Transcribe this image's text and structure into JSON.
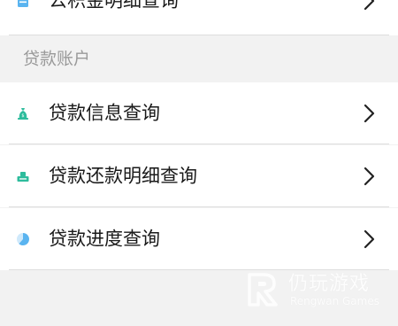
{
  "top_row": {
    "label": "公积金明细查询",
    "icon": "document-icon"
  },
  "section": {
    "title": "贷款账户"
  },
  "loan_items": [
    {
      "label": "贷款信息查询",
      "icon": "money-bag-icon"
    },
    {
      "label": "贷款还款明细查询",
      "icon": "repayment-tray-icon"
    },
    {
      "label": "贷款进度查询",
      "icon": "progress-pie-icon"
    }
  ],
  "watermark": {
    "title": "仍玩游戏",
    "subtitle": "Rengwan Games"
  },
  "colors": {
    "icon_teal": "#2dbc9c",
    "progress_blue": "#5ab4f0",
    "page_bg": "#f2f2f2",
    "row_bg": "#ffffff"
  }
}
